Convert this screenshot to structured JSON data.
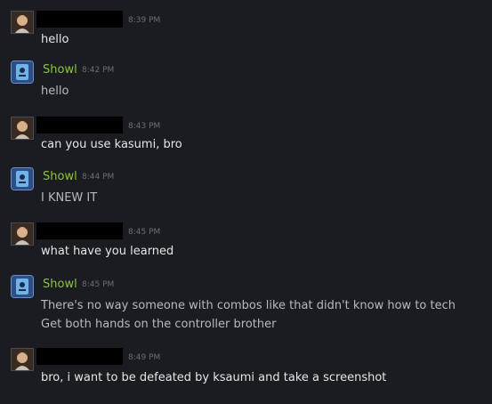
{
  "colors": {
    "background": "#1b1c22",
    "bot_name": "#8bc53f",
    "timestamp": "#6d6e72",
    "user_text": "#e6e6e6",
    "bot_text": "#b8b9bd",
    "redaction": "#000000"
  },
  "messages": [
    {
      "sender": "",
      "redacted": true,
      "avatar_icon": "user-avatar-icon",
      "time": "8:39 PM",
      "lines": [
        "hello"
      ]
    },
    {
      "sender": "Showl",
      "redacted": false,
      "avatar_icon": "bot-avatar-icon",
      "time": "8:42 PM",
      "lines": [
        "hello"
      ]
    },
    {
      "sender": "",
      "redacted": true,
      "avatar_icon": "user-avatar-icon",
      "time": "8:43 PM",
      "lines": [
        "can you use kasumi, bro"
      ]
    },
    {
      "sender": "Showl",
      "redacted": false,
      "avatar_icon": "bot-avatar-icon",
      "time": "8:44 PM",
      "lines": [
        "I KNEW IT"
      ]
    },
    {
      "sender": "",
      "redacted": true,
      "avatar_icon": "user-avatar-icon",
      "time": "8:45 PM",
      "lines": [
        "what have you learned"
      ]
    },
    {
      "sender": "Showl",
      "redacted": false,
      "avatar_icon": "bot-avatar-icon",
      "time": "8:45 PM",
      "lines": [
        "There's no way someone with combos like that didn't know how to tech",
        "Get both hands on the controller brother"
      ]
    },
    {
      "sender": "",
      "redacted": true,
      "avatar_icon": "user-avatar-icon",
      "time": "8:49 PM",
      "lines": [
        "bro, i want to be defeated by ksaumi and take a screenshot"
      ]
    }
  ]
}
